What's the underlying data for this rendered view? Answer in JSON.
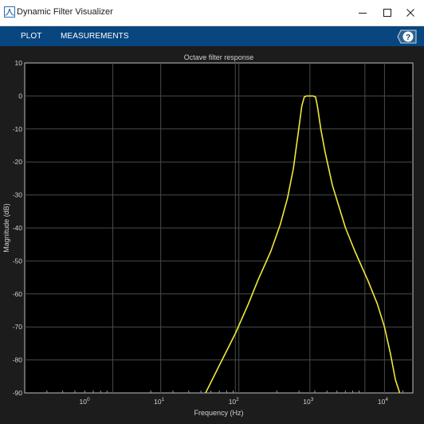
{
  "window": {
    "title": "Dynamic Filter Visualizer"
  },
  "toolstrip": {
    "tabs": [
      "PLOT",
      "MEASUREMENTS"
    ]
  },
  "icons": {
    "app": "filter-visualizer-icon",
    "minimize": "minimize-icon",
    "maximize": "maximize-icon",
    "close": "close-icon",
    "help": "help-icon"
  },
  "colors": {
    "toolstrip": "#08467f",
    "plot_background": "#000000",
    "axes_text": "#d0d0d0",
    "grid": "#4a4a4a",
    "series": "#f0e83a"
  },
  "chart_data": {
    "type": "line",
    "title": "Octave filter response",
    "xlabel": "Frequency (Hz)",
    "ylabel": "Magnitude (dB)",
    "xscale": "log",
    "xlim": [
      20,
      24000
    ],
    "ylim": [
      -90,
      10
    ],
    "yticks": [
      10,
      0,
      -10,
      -20,
      -30,
      -40,
      -50,
      -60,
      -70,
      -80,
      -90
    ],
    "xticks": [
      {
        "value": 1,
        "label": "10",
        "exp": "0"
      },
      {
        "value": 10,
        "label": "10",
        "exp": "1"
      },
      {
        "value": 100,
        "label": "10",
        "exp": "2"
      },
      {
        "value": 1000,
        "label": "10",
        "exp": "3"
      },
      {
        "value": 10000,
        "label": "10",
        "exp": "4"
      }
    ],
    "grid": true,
    "series": [
      {
        "x": [
          40,
          60,
          100,
          150,
          200,
          300,
          400,
          500,
          600,
          700,
          780,
          840,
          900,
          1000,
          1100,
          1190,
          1260,
          1400,
          1600,
          2000,
          3000,
          4000,
          6000,
          8000,
          10000,
          12000,
          14000,
          16000
        ],
        "values": [
          -92,
          -82,
          -72,
          -63,
          -56,
          -47,
          -39,
          -31,
          -22,
          -11,
          -3,
          -0.3,
          0,
          0,
          0,
          -0.3,
          -3,
          -10,
          -17,
          -27,
          -40,
          -47,
          -56,
          -63,
          -70,
          -78,
          -86,
          -93
        ]
      }
    ]
  }
}
